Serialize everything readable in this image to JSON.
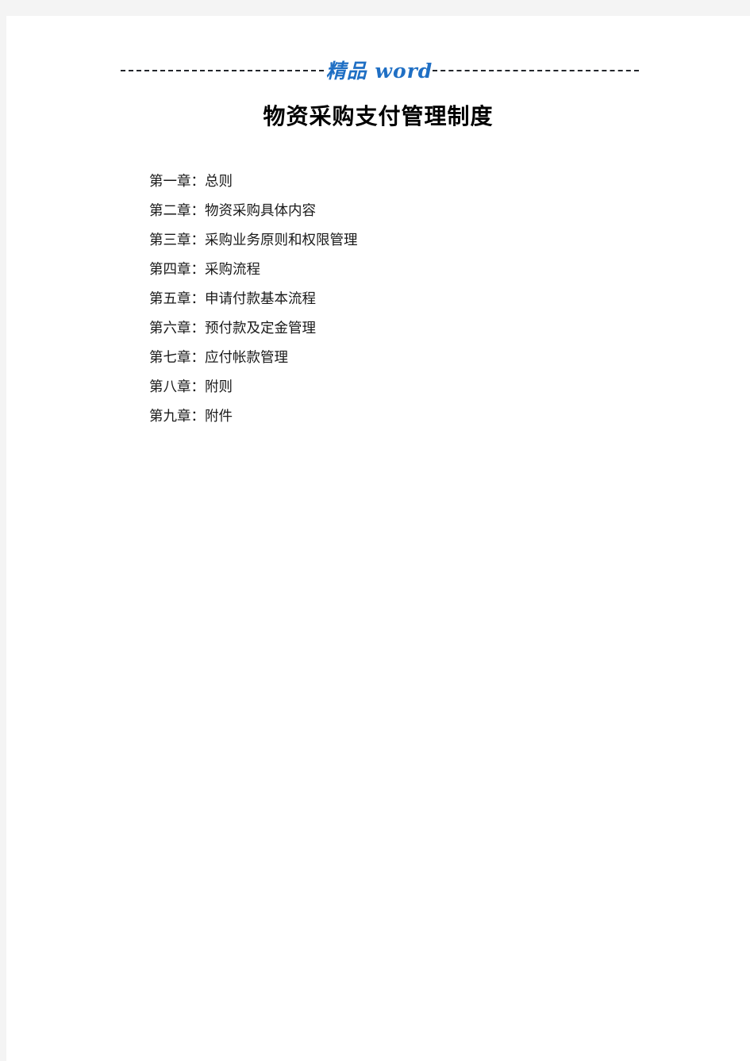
{
  "watermark": {
    "text": "精品 word",
    "color": "#1f6fc4",
    "rule_color": "#23262b"
  },
  "document": {
    "title": "物资采购支付管理制度",
    "toc": [
      {
        "label": "第一章：",
        "text": "总则"
      },
      {
        "label": "第二章：",
        "text": "物资采购具体内容"
      },
      {
        "label": "第三章：",
        "text": "采购业务原则和权限管理"
      },
      {
        "label": "第四章：",
        "text": "采购流程"
      },
      {
        "label": "第五章：",
        "text": "申请付款基本流程"
      },
      {
        "label": "第六章：",
        "text": "预付款及定金管理"
      },
      {
        "label": "第七章：",
        "text": "应付帐款管理"
      },
      {
        "label": "第八章：",
        "text": "附则"
      },
      {
        "label": "第九章：",
        "text": "附件"
      }
    ]
  }
}
